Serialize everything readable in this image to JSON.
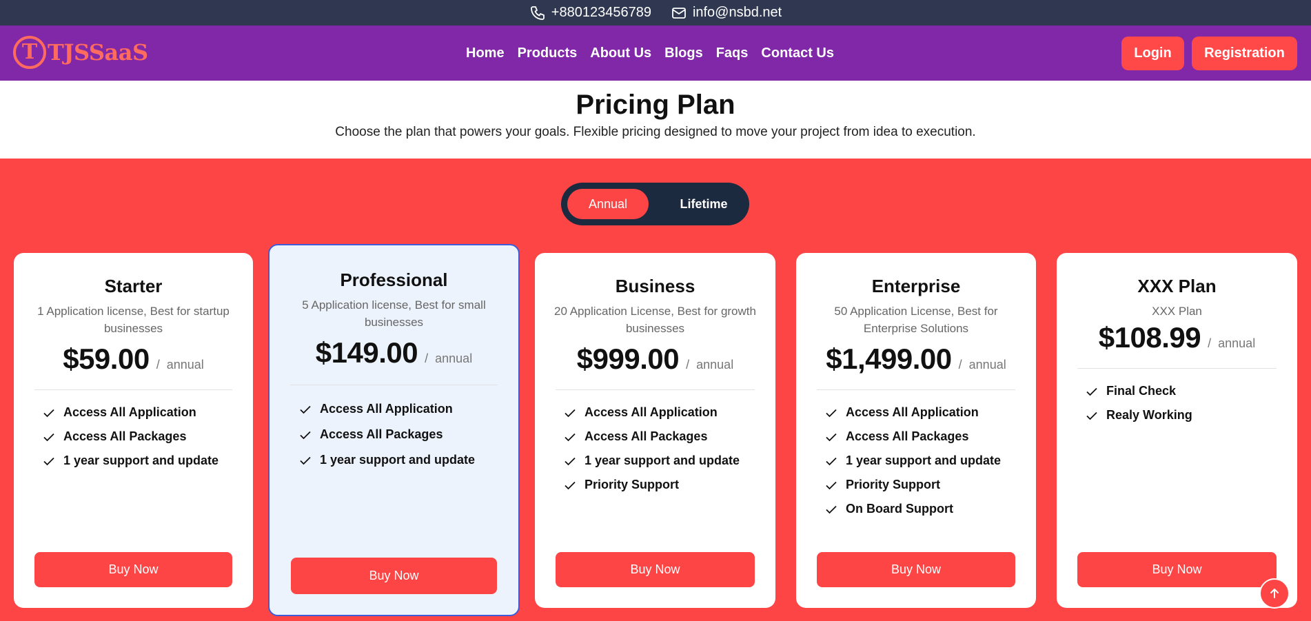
{
  "topbar": {
    "phone": "+880123456789",
    "email": "info@nsbd.net"
  },
  "logo": {
    "letter": "T",
    "text": "TJSSaaS"
  },
  "nav": {
    "links": [
      "Home",
      "Products",
      "About Us",
      "Blogs",
      "Faqs",
      "Contact Us"
    ],
    "login_label": "Login",
    "registration_label": "Registration"
  },
  "heading": {
    "title": "Pricing Plan",
    "subtitle": "Choose the plan that powers your goals. Flexible pricing designed to move your project from idea to execution."
  },
  "toggle": {
    "options": [
      "Annual",
      "Lifetime"
    ],
    "selected": "Annual"
  },
  "plans": [
    {
      "name": "Starter",
      "description": "1 Application license, Best for startup businesses",
      "price": "$59.00",
      "separator": "/",
      "period": "annual",
      "features": [
        "Access All Application",
        "Access All Packages",
        "1 year support and update"
      ],
      "button": "Buy Now"
    },
    {
      "name": "Professional",
      "description": "5 Application license, Best for small businesses",
      "price": "$149.00",
      "separator": "/",
      "period": "annual",
      "features": [
        "Access All Application",
        "Access All Packages",
        "1 year support and update"
      ],
      "button": "Buy Now"
    },
    {
      "name": "Business",
      "description": "20 Application License, Best for growth businesses",
      "price": "$999.00",
      "separator": "/",
      "period": "annual",
      "features": [
        "Access All Application",
        "Access All Packages",
        "1 year support and update",
        "Priority Support"
      ],
      "button": "Buy Now"
    },
    {
      "name": "Enterprise",
      "description": "50 Application License, Best for Enterprise Solutions",
      "price": "$1,499.00",
      "separator": "/",
      "period": "annual",
      "features": [
        "Access All Application",
        "Access All Packages",
        "1 year support and update",
        "Priority Support",
        "On Board Support"
      ],
      "button": "Buy Now"
    },
    {
      "name": "XXX Plan",
      "description": "XXX Plan",
      "price": "$108.99",
      "separator": "/",
      "period": "annual",
      "features": [
        "Final Check",
        "Realy Working"
      ],
      "button": "Buy Now"
    }
  ],
  "colors": {
    "topbar": "#2f3850",
    "navbar": "#8028a8",
    "accent": "#fe4545",
    "logo": "#ff6b5e",
    "toggle_bg": "#1c2a40",
    "featured_bg": "#edf3fc",
    "featured_border": "#3d5bd9"
  },
  "icons": {
    "phone": "phone-icon",
    "email": "envelope-icon",
    "feature": "check-icon",
    "scroll": "arrow-up-icon"
  }
}
